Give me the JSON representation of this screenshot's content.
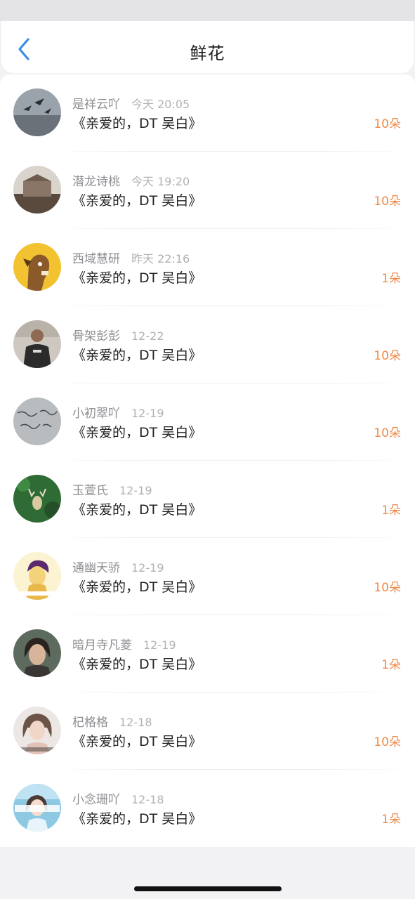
{
  "header": {
    "title": "鲜花"
  },
  "icons": {
    "back": "chevron-left-icon"
  },
  "colors": {
    "accent": "#3a8ee6",
    "count": "#ee8a4a",
    "meta": "#8e8e93"
  },
  "rows": [
    {
      "name": "是祥云吖",
      "time": "今天 20:05",
      "work": "《亲爱的，DT 吴白》",
      "count": "10朵"
    },
    {
      "name": "潜龙诗桃",
      "time": "今天 19:20",
      "work": "《亲爱的，DT 吴白》",
      "count": "10朵"
    },
    {
      "name": "西域慧研",
      "time": "昨天 22:16",
      "work": "《亲爱的，DT 吴白》",
      "count": "1朵"
    },
    {
      "name": "骨架彭彭",
      "time": "12-22",
      "work": "《亲爱的，DT 吴白》",
      "count": "10朵"
    },
    {
      "name": "小初翠吖",
      "time": "12-19",
      "work": "《亲爱的，DT 吴白》",
      "count": "10朵"
    },
    {
      "name": "玉萱氏",
      "time": "12-19",
      "work": "《亲爱的，DT 吴白》",
      "count": "1朵"
    },
    {
      "name": "通幽天骄",
      "time": "12-19",
      "work": "《亲爱的，DT 吴白》",
      "count": "10朵"
    },
    {
      "name": "暗月寺凡菱",
      "time": "12-19",
      "work": "《亲爱的，DT 吴白》",
      "count": "1朵"
    },
    {
      "name": "杞格格",
      "time": "12-18",
      "work": "《亲爱的，DT 吴白》",
      "count": "10朵"
    },
    {
      "name": "小念珊吖",
      "time": "12-18",
      "work": "《亲爱的，DT 吴白》",
      "count": "1朵"
    }
  ]
}
